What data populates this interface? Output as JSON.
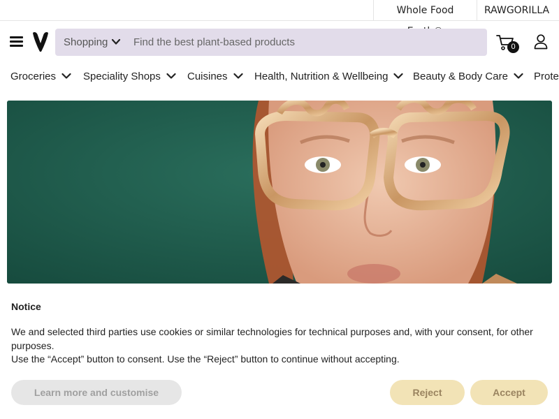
{
  "topbar": {
    "links": [
      "Whole Food Earth®",
      "RAWGORILLA"
    ]
  },
  "header": {
    "logo": "v-logo-icon",
    "search": {
      "department": "Shopping",
      "placeholder": "Find the best plant-based products",
      "value": ""
    },
    "cart_count": "0"
  },
  "nav": {
    "categories": [
      "Groceries",
      "Speciality Shops",
      "Cuisines",
      "Health, Nutrition & Wellbeing",
      "Beauty & Body Care",
      "Protei"
    ]
  },
  "hero": {
    "image": "woman-with-gold-party-glasses"
  },
  "cookie": {
    "title": "Notice",
    "line1": "We and selected third parties use cookies or similar technologies for technical purposes and, with your consent, for other purposes.",
    "line2": "Use the “Accept” button to consent. Use the “Reject” button to continue without accepting.",
    "learn_label": "Learn more and customise",
    "reject_label": "Reject",
    "accept_label": "Accept"
  },
  "colors": {
    "search_bg": "#e2dcea",
    "hero_bg": "#1d5a4a",
    "consent_button_bg": "#f2e3b6",
    "consent_button_text": "#9a8460"
  }
}
